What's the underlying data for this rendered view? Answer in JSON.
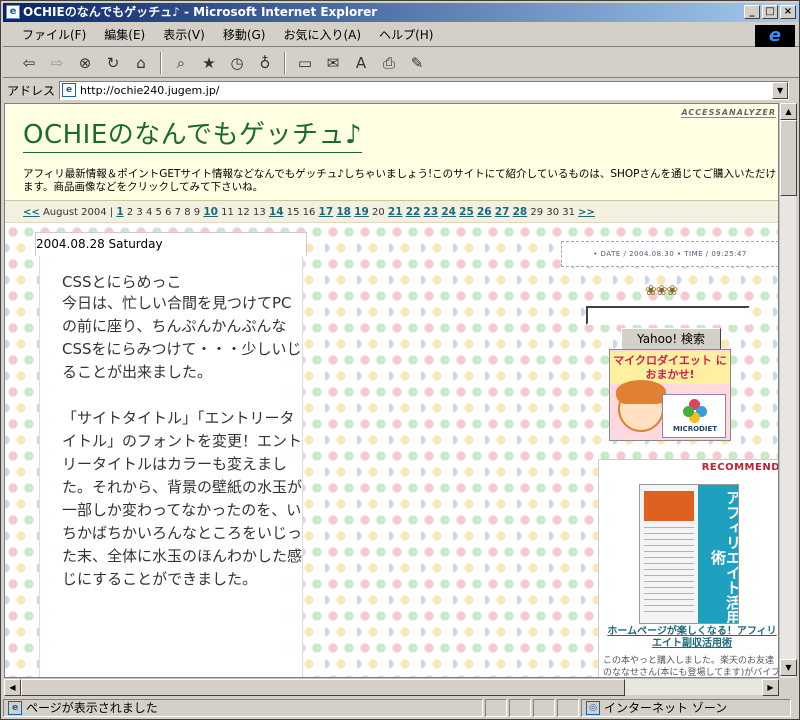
{
  "window": {
    "title": "OCHIEのなんでもゲッチュ♪ - Microsoft Internet Explorer",
    "minimize": "_",
    "maximize": "□",
    "close": "×"
  },
  "menu": [
    "ファイル(F)",
    "編集(E)",
    "表示(V)",
    "移動(G)",
    "お気に入り(A)",
    "ヘルプ(H)"
  ],
  "address": {
    "label": "アドレス",
    "url": "http://ochie240.jugem.jp/"
  },
  "status": {
    "text": "ページが表示されました",
    "zone": "インターネット ゾーン"
  },
  "page": {
    "site_title": "OCHIEのなんでもゲッチュ♪",
    "access_logo": "ACCESSANALYZER",
    "description": "アフィリ最新情報＆ポイントGETサイト情報などなんでもゲッチュ♪しちゃいましょう!このサイトにて紹介しているものは、SHOPさんを通じてご購入いただけます。商品画像などをクリックしてみて下さいね。",
    "calendar": {
      "prev": "<<",
      "month": "August 2004",
      "next": ">>",
      "days": [
        {
          "d": "1",
          "link": true
        },
        {
          "d": "2",
          "link": false
        },
        {
          "d": "3",
          "link": false
        },
        {
          "d": "4",
          "link": false
        },
        {
          "d": "5",
          "link": false
        },
        {
          "d": "6",
          "link": false
        },
        {
          "d": "7",
          "link": false
        },
        {
          "d": "8",
          "link": false
        },
        {
          "d": "9",
          "link": false
        },
        {
          "d": "10",
          "link": true
        },
        {
          "d": "11",
          "link": false
        },
        {
          "d": "12",
          "link": false
        },
        {
          "d": "13",
          "link": false
        },
        {
          "d": "14",
          "link": true
        },
        {
          "d": "15",
          "link": false
        },
        {
          "d": "16",
          "link": false
        },
        {
          "d": "17",
          "link": true
        },
        {
          "d": "18",
          "link": true
        },
        {
          "d": "19",
          "link": true
        },
        {
          "d": "20",
          "link": false
        },
        {
          "d": "21",
          "link": true
        },
        {
          "d": "22",
          "link": true
        },
        {
          "d": "23",
          "link": true
        },
        {
          "d": "24",
          "link": true
        },
        {
          "d": "25",
          "link": true
        },
        {
          "d": "26",
          "link": true
        },
        {
          "d": "27",
          "link": true
        },
        {
          "d": "28",
          "link": true
        },
        {
          "d": "29",
          "link": false
        },
        {
          "d": "30",
          "link": false
        },
        {
          "d": "31",
          "link": false
        }
      ]
    },
    "entry": {
      "date": "2004.08.28 Saturday",
      "title": "CSSとにらめっこ",
      "p1": "今日は、忙しい合間を見つけてPCの前に座り、ちんぷんかんぷんなCSSをにらみつけて・・・少しいじることが出来ました。",
      "p2": "「サイトタイトル」「エントリータイトル」のフォントを変更！エントリータイトルはカラーも変えました。それから、背景の壁紙の水玉が一部しか変わってなかったのを、いちかばちかいろんなところをいじった末、全体に水玉のほんわかした感じにすることができました。"
    },
    "sidebar": {
      "datetime": "• DATE / 2004.08.30 • TIME / 09:25:47",
      "search_button": "Yahoo! 検索",
      "banner_text": "マイクロダイエット におまかせ!",
      "banner_logo": "MICRODIET",
      "recommend": "RECOMMEND",
      "book_title": "ホームページが楽しくなる！アフィリエイト副収活用術",
      "book_side": "アフィリエイト活用術",
      "book_desc": "この本やっと購入しました。楽天のお友達のななせさん(本にも登場してます)がバイブルだと言ってました..."
    }
  }
}
